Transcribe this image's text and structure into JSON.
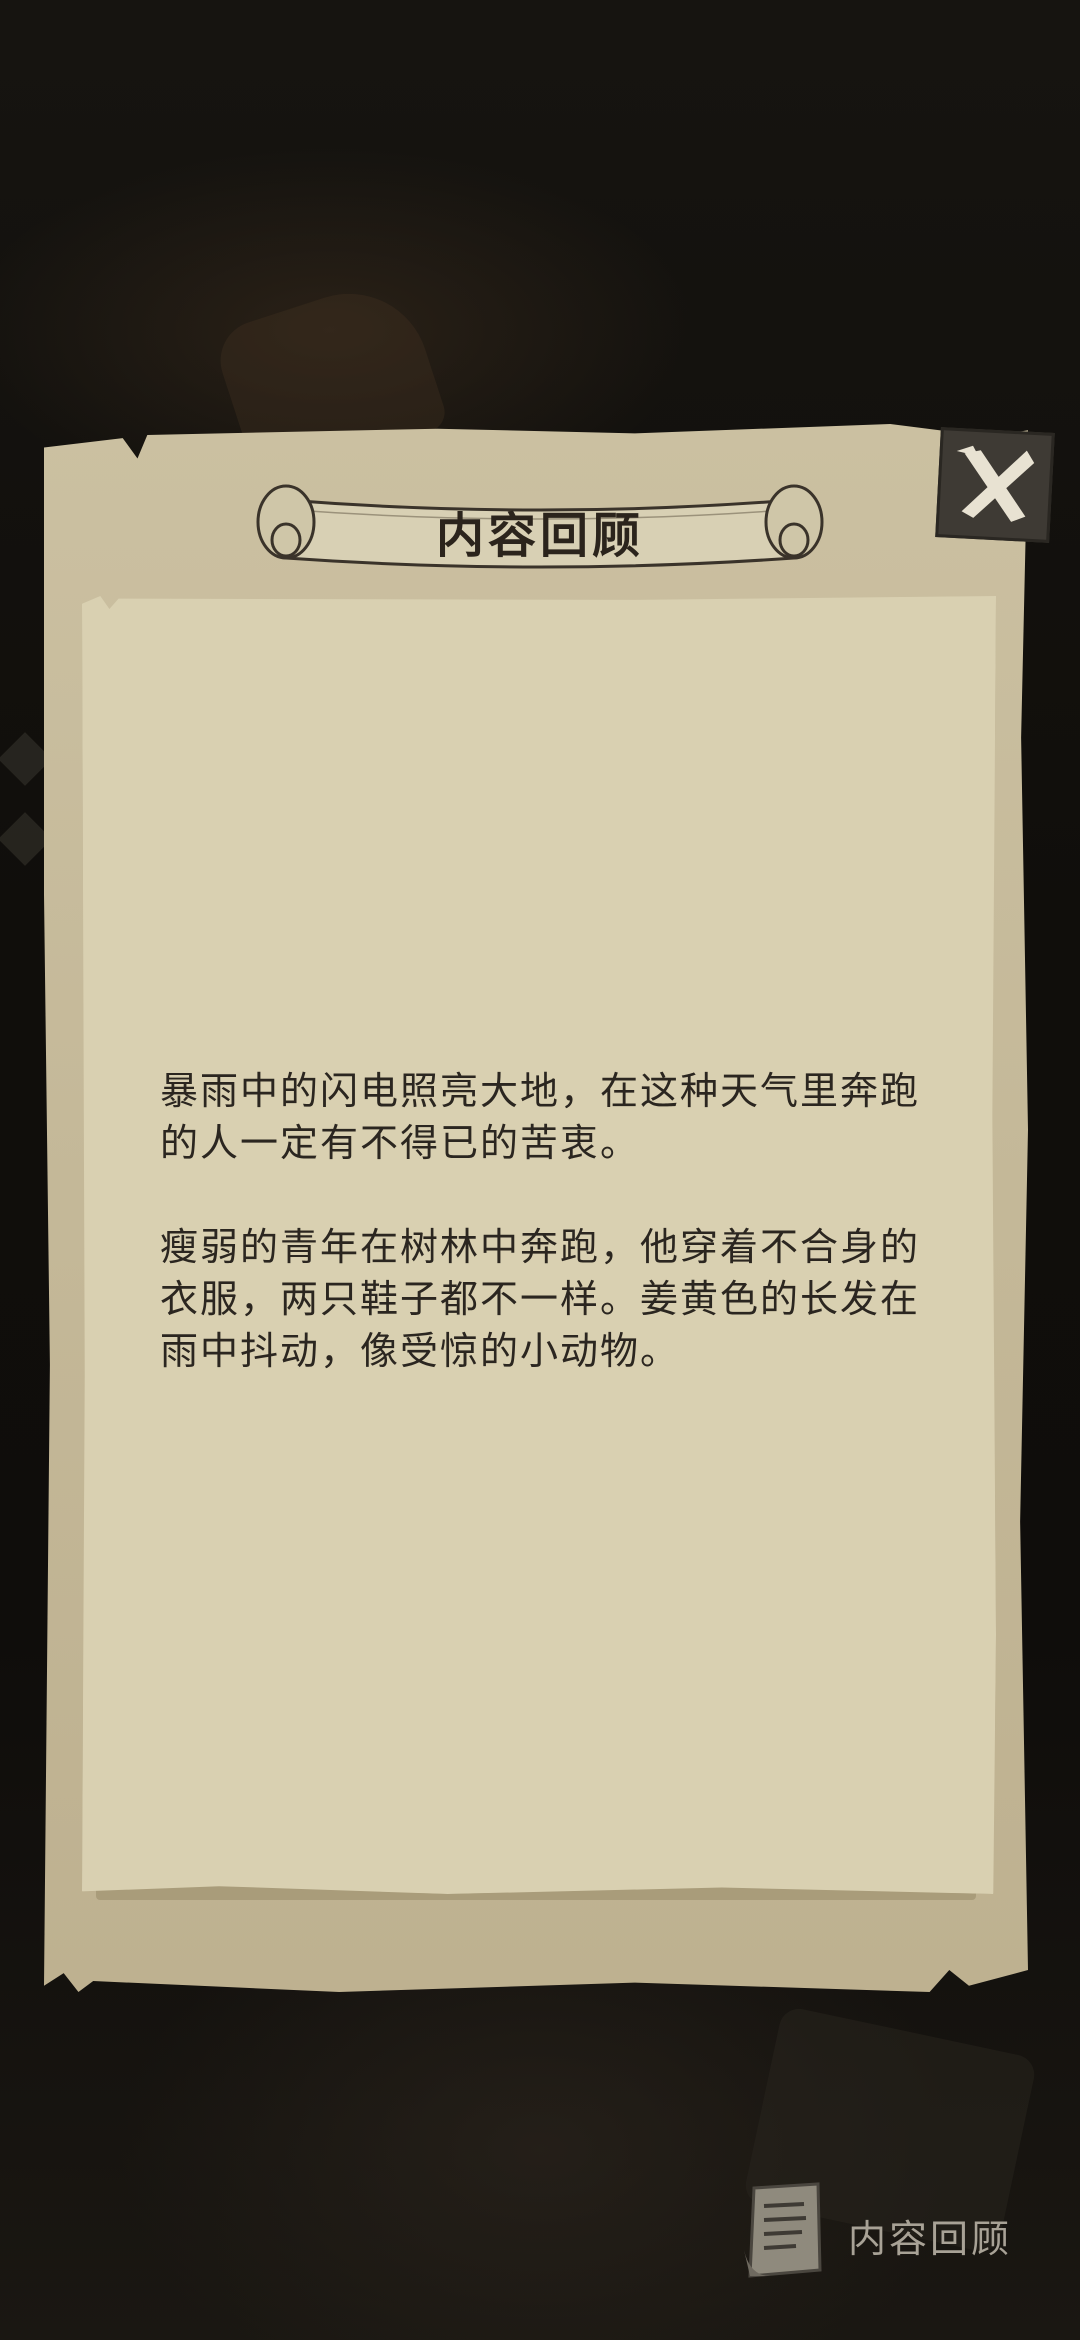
{
  "dialog": {
    "title": "内容回顾",
    "close_icon": "close-x-icon",
    "paragraphs": [
      "暴雨中的闪电照亮大地，在这种天气里奔跑的人一定有不得已的苦衷。",
      "瘦弱的青年在树林中奔跑，他穿着不合身的衣服，两只鞋子都不一样。姜黄色的长发在雨中抖动，像受惊的小动物。"
    ]
  },
  "review_button": {
    "label": "内容回顾",
    "icon": "scroll-note-icon"
  },
  "colors": {
    "background": "#0c0b09",
    "parchment": "#c4b898",
    "paper": "#d9d0b1",
    "text": "#2b2620",
    "close_button": "#3e3a34"
  }
}
